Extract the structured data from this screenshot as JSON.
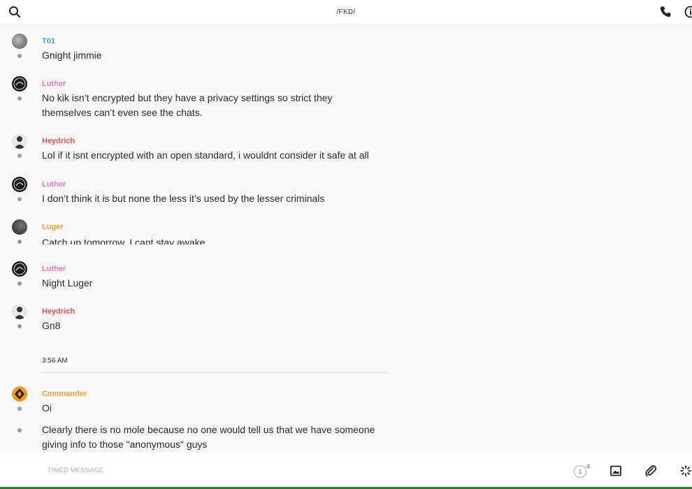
{
  "header": {
    "title": "/FKD/",
    "search_icon": "search-icon",
    "call_icon": "phone-icon",
    "info_icon": "info-icon"
  },
  "colors": {
    "t01": "#4aa3d8",
    "luther": "#e07ab8",
    "heydrich": "#d9534f",
    "luger": "#f0a030",
    "commander": "#f0a030",
    "commander_avatar": "#f09a1a"
  },
  "messages": [
    {
      "sender": "T01",
      "text": "Gnight jimmie"
    },
    {
      "sender": "Luther",
      "text_line1": "No kik isn’t encrypted but they have a privacy settings so strict they",
      "text_line2": "themselves can’t even see the chats."
    },
    {
      "sender": "Heydrich",
      "text": "Lol if it isnt encrypted with an open standard, i wouldnt consider it safe at all"
    },
    {
      "sender": "Luther",
      "text": "I don’t think it is but none the less it’s used by the lesser criminals"
    },
    {
      "sender": "Luger",
      "text": "Catch  up tomorrow, I cant stay awake"
    },
    {
      "sender": "Luther",
      "text": "Night Luger"
    },
    {
      "sender": "Heydrich",
      "text": "Gn8"
    }
  ],
  "time_separator": "3:56 AM",
  "later_messages": [
    {
      "sender": "Commander",
      "text": "Oi"
    },
    {
      "sender": "",
      "text_line1": "Clearly there is no mole because no one would tell us that we have someone",
      "text_line2": "giving info to those \"anonymous\" guys"
    }
  ],
  "composer": {
    "placeholder": "TIMED MESSAGE",
    "timer_value": "1",
    "timer_unit": "d"
  }
}
